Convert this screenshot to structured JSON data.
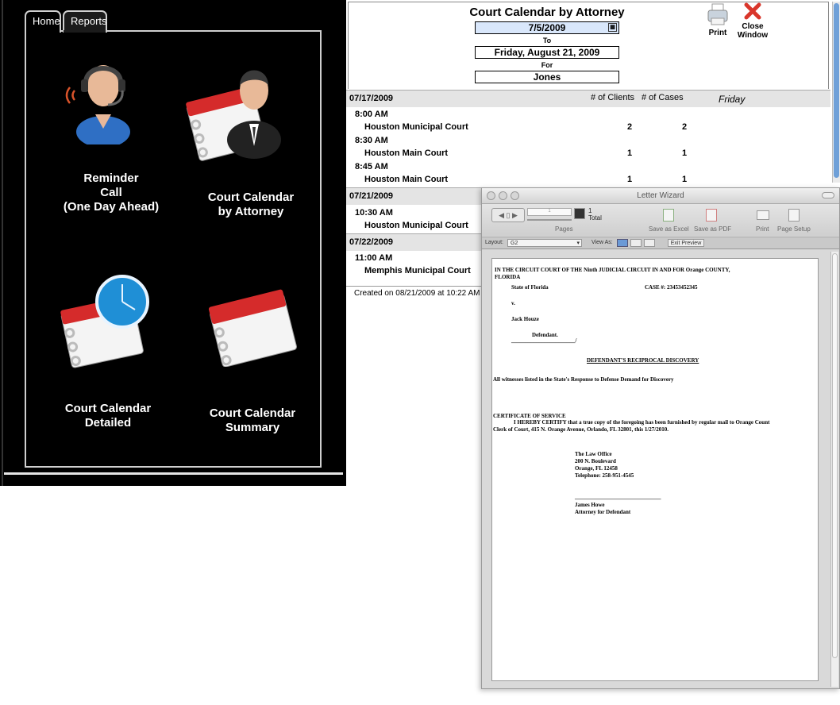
{
  "launcher": {
    "tabs": [
      "Home",
      "Reports"
    ],
    "tiles": [
      {
        "line1": "Reminder",
        "line2": "Call",
        "line3": "(One Day Ahead)"
      },
      {
        "line1": "Court Calendar",
        "line2": "by Attorney"
      },
      {
        "line1": "Court Calendar",
        "line2": "Detailed"
      },
      {
        "line1": "Court Calendar",
        "line2": "Summary"
      }
    ]
  },
  "report": {
    "title": "Court Calendar by Attorney",
    "from_date": "7/5/2009",
    "to_label": "To",
    "to_date": "Friday, August 21, 2009",
    "for_label": "For",
    "attorney": "Jones",
    "print_label": "Print",
    "close_label_1": "Close",
    "close_label_2": "Window",
    "days": [
      {
        "date": "07/17/2009",
        "clients_header": "# of Clients",
        "cases_header": "# of Cases",
        "weekday": "Friday",
        "slots": [
          {
            "time": "8:00 AM",
            "court": "Houston Municipal Court",
            "clients": "2",
            "cases": "2"
          },
          {
            "time": "8:30 AM",
            "court": "Houston Main Court",
            "clients": "1",
            "cases": "1"
          },
          {
            "time": "8:45 AM",
            "court": "Houston Main Court",
            "clients": "1",
            "cases": "1"
          }
        ]
      },
      {
        "date": "07/21/2009",
        "slots": [
          {
            "time": "10:30 AM",
            "court": "Houston Municipal Court"
          }
        ]
      },
      {
        "date": "07/22/2009",
        "slots": [
          {
            "time": "11:00 AM",
            "court": "Memphis Municipal Court"
          }
        ]
      }
    ],
    "created": "Created on 08/21/2009 at 10:22 AM"
  },
  "wizard": {
    "title": "Letter Wizard",
    "page_current": "1",
    "page_total_num": "1",
    "page_total_label": "Total",
    "pages_label": "Pages",
    "save_excel": "Save as Excel",
    "save_pdf": "Save as PDF",
    "print": "Print",
    "page_setup": "Page Setup",
    "layout_label": "Layout:",
    "layout_value": "G2",
    "view_as_label": "View As:",
    "exit_preview": "Exit Preview",
    "doc": {
      "heading1": "IN THE CIRCUIT COURT OF THE Ninth JUDICIAL CIRCUIT IN AND FOR Orange COUNTY,",
      "heading2": "FLORIDA",
      "state": "State of Florida",
      "case": "CASE #: 23453452345",
      "v": "v.",
      "defendant_name": "Jack Houze",
      "defendant_label": "Defendant.",
      "underline": "_______________________/",
      "doc_title": "DEFENDANT'S RECIPROCAL DISCOVERY",
      "witnesses": "All witnesses listed in the State's Response to Defense Demand for Discovery",
      "cert_title": "CERTIFICATE OF SERVICE",
      "cert_line1": "I HEREBY CERTIFY that a true copy of the foregoing has been furnished by regular mail to  Orange Count",
      "cert_line2": "Clerk of Court, 415 N. Orange Avenue, Orlando, FL 32801, this 1/27/2010.",
      "firm": "The Law Office",
      "addr1": "200 N. Boulevard",
      "addr2": "Orange, FL 12458",
      "phone": "Telephone: 258-951-4545",
      "sig_line": "_______________________________",
      "signer": "James Howe",
      "signer_title": "Attorney for Defendant"
    }
  }
}
